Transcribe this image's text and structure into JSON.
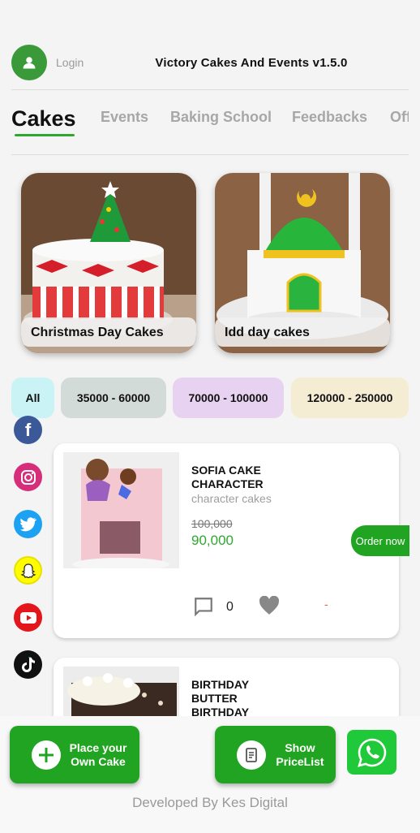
{
  "header": {
    "login_label": "Login",
    "app_title": "Victory Cakes And Events v1.5.0"
  },
  "tabs": [
    {
      "label": "Cakes",
      "active": true
    },
    {
      "label": "Events"
    },
    {
      "label": "Baking School"
    },
    {
      "label": "Feedbacks"
    },
    {
      "label": "Offers"
    }
  ],
  "categories": [
    {
      "label": "Christmas Day Cakes"
    },
    {
      "label": "Idd day cakes"
    }
  ],
  "price_filters": [
    {
      "label": "All",
      "color": "#c9f3f5"
    },
    {
      "label": "35000 - 60000",
      "color": "#d3dbd8"
    },
    {
      "label": "70000 - 100000",
      "color": "#e7d3f1"
    },
    {
      "label": "120000 - 250000",
      "color": "#f5ecd4"
    }
  ],
  "social": [
    "facebook-icon",
    "instagram-icon",
    "twitter-icon",
    "snapchat-icon",
    "youtube-icon",
    "tiktok-icon"
  ],
  "products": [
    {
      "name": "SOFIA CAKE CHARACTER",
      "category": "character cakes",
      "old_price": "100,000",
      "price": "90,000",
      "comments": "0",
      "status": "-"
    },
    {
      "name": "BIRTHDAY BUTTER BIRTHDAY CAKE"
    }
  ],
  "order_now_label": "Order now",
  "actions": {
    "place_own_cake": "Place your Own Cake",
    "show_pricelist": "Show PriceList"
  },
  "footer": "Developed By Kes Digital",
  "colors": {
    "accent": "#21a421",
    "whatsapp": "#1fc93a"
  }
}
